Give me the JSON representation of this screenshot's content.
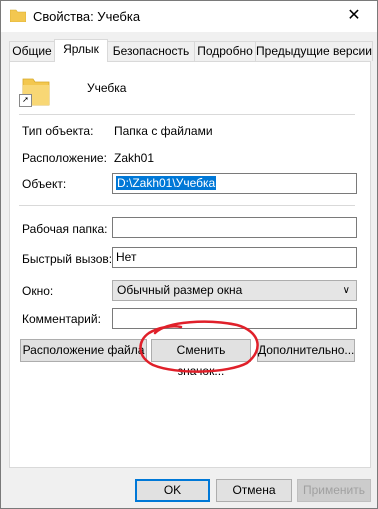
{
  "window": {
    "title": "Свойства: Учебка",
    "close_glyph": "✕"
  },
  "tabs": [
    {
      "label": "Общие"
    },
    {
      "label": "Ярлык"
    },
    {
      "label": "Безопасность"
    },
    {
      "label": "Подробно"
    },
    {
      "label": "Предыдущие версии"
    }
  ],
  "active_tab": "Ярлык",
  "shortcut": {
    "name": "Учебка",
    "type_label": "Тип объекта:",
    "type_value": "Папка с файлами",
    "location_label": "Расположение:",
    "location_value": "Zakh01",
    "target_label": "Объект:",
    "target_value": "D:\\Zakh01\\Учебка",
    "start_in_label": "Рабочая папка:",
    "start_in_value": "",
    "hotkey_label": "Быстрый вызов:",
    "hotkey_value": "Нет",
    "run_label": "Окно:",
    "run_value": "Обычный размер окна",
    "comment_label": "Комментарий:",
    "comment_value": ""
  },
  "buttons": {
    "open_location": "Расположение файла",
    "change_icon": "Сменить значок...",
    "advanced": "Дополнительно...",
    "ok": "OK",
    "cancel": "Отмена",
    "apply": "Применить"
  },
  "icons": {
    "title": "folder-icon",
    "big": "folder-shortcut-icon",
    "arrow": "shortcut-arrow-icon"
  },
  "colors": {
    "selection": "#0078d7",
    "annotation": "#e0202a",
    "folder": "#f3c74f"
  }
}
